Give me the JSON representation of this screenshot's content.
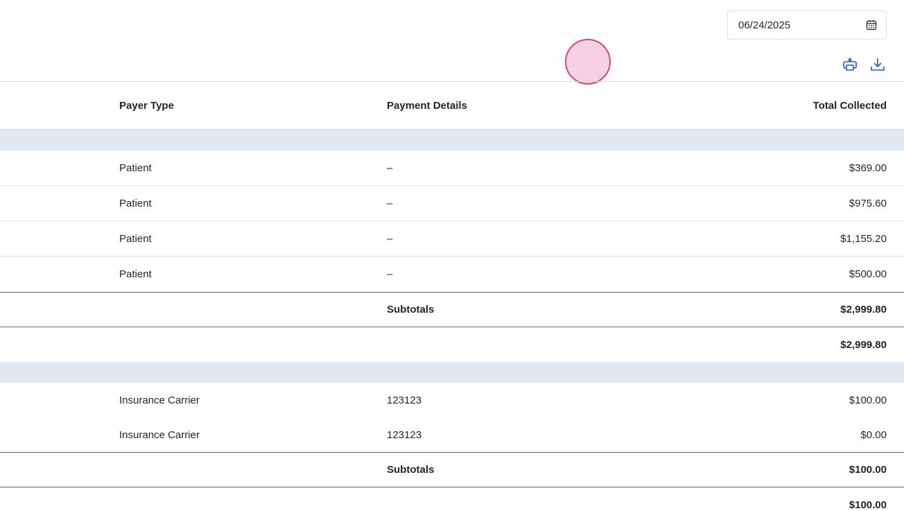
{
  "date_picker": {
    "value": "06/24/2025",
    "icon": "calendar-icon"
  },
  "toolbar": {
    "print_icon": "printer-icon",
    "download_icon": "download-icon"
  },
  "colors": {
    "accent": "#1a56db",
    "group_band": "#e1e8f0",
    "click_indicator": "#d6437f"
  },
  "table": {
    "headers": {
      "payer_type": "Payer Type",
      "payment_details": "Payment Details",
      "total_collected": "Total Collected"
    },
    "group1": {
      "rows": [
        {
          "payer": "Patient",
          "details": "–",
          "total": "$369.00"
        },
        {
          "payer": "Patient",
          "details": "–",
          "total": "$975.60"
        },
        {
          "payer": "Patient",
          "details": "–",
          "total": "$1,155.20"
        },
        {
          "payer": "Patient",
          "details": "–",
          "total": "$500.00"
        }
      ],
      "subtotal_label": "Subtotals",
      "subtotal": "$2,999.80",
      "total": "$2,999.80"
    },
    "group2": {
      "rows": [
        {
          "payer": "Insurance Carrier",
          "details": "123123",
          "total": "$100.00"
        },
        {
          "payer": "Insurance Carrier",
          "details": "123123",
          "total": "$0.00"
        }
      ],
      "subtotal_label": "Subtotals",
      "subtotal": "$100.00",
      "total": "$100.00"
    }
  }
}
